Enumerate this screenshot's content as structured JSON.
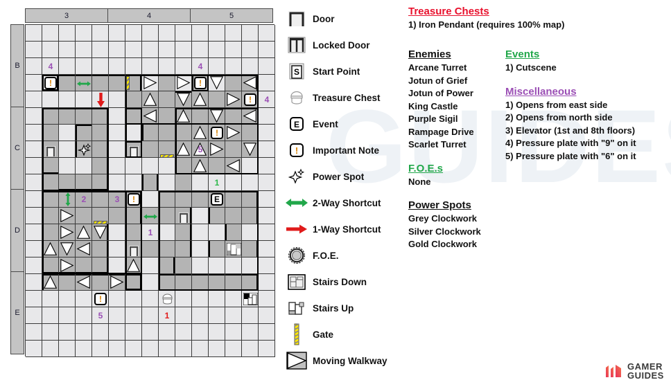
{
  "map": {
    "col_headers": [
      "3",
      "4",
      "5"
    ],
    "row_headers": [
      "B",
      "C",
      "D",
      "E"
    ],
    "grid_cols": 15,
    "grid_rows": 20,
    "markers": [
      {
        "type": "number",
        "value": "4",
        "color": "purple",
        "col": 1,
        "row": 2
      },
      {
        "type": "number",
        "value": "4",
        "color": "purple",
        "col": 10,
        "row": 2
      },
      {
        "type": "note",
        "value": "!",
        "col": 1,
        "row": 3
      },
      {
        "type": "note",
        "value": "!",
        "col": 10,
        "row": 3
      },
      {
        "type": "note",
        "value": "!",
        "col": 13,
        "row": 4
      },
      {
        "type": "number",
        "value": "4",
        "color": "purple",
        "col": 14,
        "row": 4
      },
      {
        "type": "note",
        "value": "!",
        "col": 11,
        "row": 6
      },
      {
        "type": "number",
        "value": "5",
        "color": "purple",
        "col": 10,
        "row": 7
      },
      {
        "type": "number",
        "value": "1",
        "color": "green",
        "col": 11,
        "row": 9
      },
      {
        "type": "number",
        "value": "2",
        "color": "purple",
        "col": 3,
        "row": 10
      },
      {
        "type": "number",
        "value": "3",
        "color": "purple",
        "col": 5,
        "row": 10
      },
      {
        "type": "note",
        "value": "!",
        "col": 6,
        "row": 10
      },
      {
        "type": "event",
        "value": "E",
        "col": 11,
        "row": 10
      },
      {
        "type": "number",
        "value": "1",
        "color": "purple",
        "col": 7,
        "row": 12
      },
      {
        "type": "note",
        "value": "!",
        "col": 4,
        "row": 16
      },
      {
        "type": "number",
        "value": "5",
        "color": "purple",
        "col": 4,
        "row": 17
      },
      {
        "type": "number",
        "value": "1",
        "color": "red",
        "col": 8,
        "row": 17
      }
    ]
  },
  "legend": {
    "items": [
      {
        "icon": "door-icon",
        "label": "Door"
      },
      {
        "icon": "locked-door-icon",
        "label": "Locked Door"
      },
      {
        "icon": "start-point-icon",
        "label": "Start Point"
      },
      {
        "icon": "treasure-chest-icon",
        "label": "Treasure Chest"
      },
      {
        "icon": "event-icon",
        "label": "Event"
      },
      {
        "icon": "important-note-icon",
        "label": "Important Note"
      },
      {
        "icon": "power-spot-icon",
        "label": "Power Spot"
      },
      {
        "icon": "two-way-shortcut-icon",
        "label": "2-Way Shortcut"
      },
      {
        "icon": "one-way-shortcut-icon",
        "label": "1-Way Shortcut"
      },
      {
        "icon": "foe-icon",
        "label": "F.O.E."
      },
      {
        "icon": "stairs-down-icon",
        "label": "Stairs Down"
      },
      {
        "icon": "stairs-up-icon",
        "label": "Stairs Up"
      },
      {
        "icon": "gate-icon",
        "label": "Gate"
      },
      {
        "icon": "moving-walkway-icon",
        "label": "Moving Walkway"
      }
    ]
  },
  "info": {
    "treasure_chests": {
      "title": "Treasure Chests",
      "color": "#e8112d",
      "lines": [
        "1) Iron Pendant (requires 100% map)"
      ]
    },
    "enemies": {
      "title": "Enemies",
      "color": "#111111",
      "lines": [
        "Arcane Turret",
        "Jotun of Grief",
        "Jotun of Power",
        "King Castle",
        "Purple Sigil",
        "Rampage Drive",
        "Scarlet Turret"
      ]
    },
    "foes": {
      "title": "F.O.E.s",
      "color": "#21a74a",
      "lines": [
        "None"
      ]
    },
    "power_spots": {
      "title": "Power Spots",
      "color": "#111111",
      "lines": [
        "Grey Clockwork",
        "Silver Clockwork",
        "Gold Clockwork"
      ]
    },
    "events": {
      "title": "Events",
      "color": "#21a74a",
      "lines": [
        "1) Cutscene"
      ]
    },
    "miscellaneous": {
      "title": "Miscellaneous",
      "color": "#9b4fb5",
      "lines": [
        "1) Opens from east side",
        "2) Opens from north side",
        "3) Elevator (1st and 8th floors)",
        "4) Pressure plate with \"9\" on it",
        "5) Pressure plate with \"6\" on it"
      ]
    }
  },
  "logo": {
    "line1": "GAMER",
    "line2": "GUIDES"
  },
  "watermark": {
    "text": "GUIDES"
  }
}
